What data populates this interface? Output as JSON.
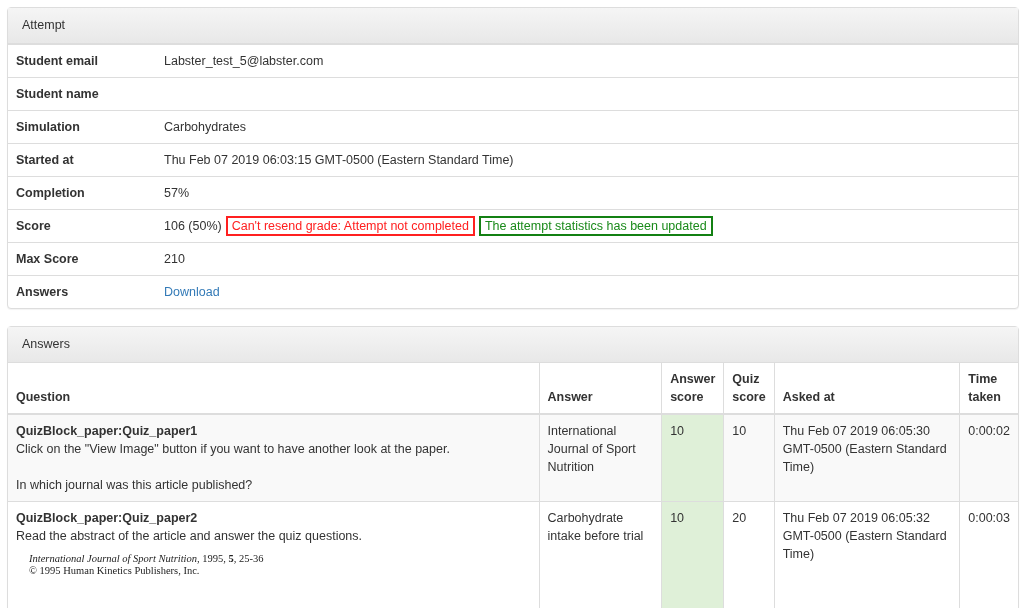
{
  "attempt": {
    "title": "Attempt",
    "rows": [
      {
        "label": "Student email",
        "value": "Labster_test_5@labster.com"
      },
      {
        "label": "Student name"
      },
      {
        "label": "Simulation",
        "value": "Carbohydrates"
      },
      {
        "label": "Started at",
        "value": "Thu Feb 07 2019 06:03:15 GMT-0500 (Eastern Standard Time)"
      },
      {
        "label": "Completion",
        "value": "57%"
      },
      {
        "label": "Score",
        "value": "106 (50%)",
        "messages": [
          {
            "kind": "error",
            "text": "Can't resend grade: Attempt not completed"
          },
          {
            "kind": "success",
            "text": "The attempt statistics has been updated"
          }
        ]
      },
      {
        "label": "Max Score",
        "value": "210"
      },
      {
        "label": "Answers",
        "link": "Download"
      }
    ]
  },
  "answers": {
    "title": "Answers",
    "columns": [
      "Question",
      "Answer",
      "Answer score",
      "Quiz score",
      "Asked at",
      "Time taken"
    ],
    "rows": [
      {
        "question": "QuizBlock_paper:Quiz_paper1",
        "paragraphs": [
          "Click on the \"View Image\" button if you want to have another look at the paper.",
          "In which journal was this article published?"
        ],
        "answer": "International Journal of Sport Nutrition",
        "answer_score": "10",
        "correct": true,
        "quiz_score": "10",
        "asked_at": "Thu Feb 07 2019 06:05:30 GMT-0500 (Eastern Standard Time)",
        "time_taken": "0:00:02"
      },
      {
        "question": "QuizBlock_paper:Quiz_paper2",
        "paragraphs": [
          "Read the abstract of the article and answer the quiz questions."
        ],
        "excerpt": [
          "*International Journal of Sport Nutrition*, 1995, **5**, 25-36",
          "© 1995 Human Kinetics Publishers, Inc."
        ],
        "answer": "Carbohydrate intake before trial",
        "answer_score": "10",
        "correct": true,
        "quiz_score": "20",
        "asked_at": "Thu Feb 07 2019 06:05:32 GMT-0500 (Eastern Standard Time)",
        "time_taken": "0:00:03"
      }
    ]
  }
}
